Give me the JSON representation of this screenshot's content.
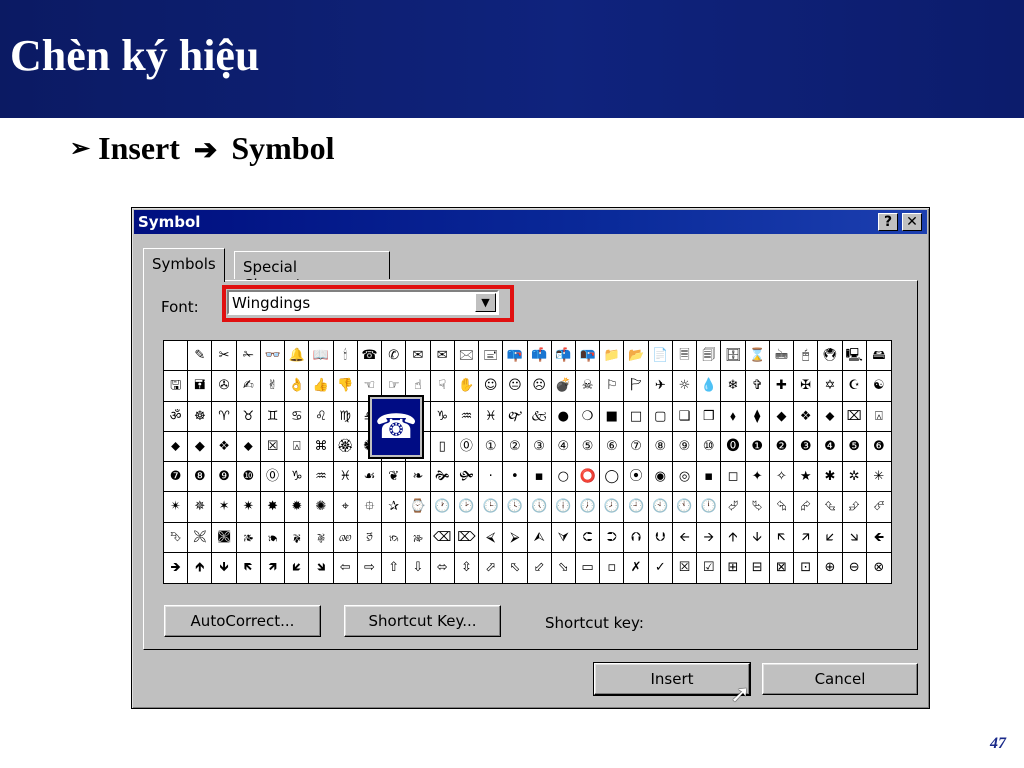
{
  "slide": {
    "title": "Chèn ký hiệu",
    "bullet_marker": "➢",
    "bullet_part1": "Insert",
    "bullet_arrow": "➔",
    "bullet_part2": "Symbol",
    "page_number": "47",
    "colors": {
      "header": "#0f237d",
      "title_text": "#ffffff",
      "highlight": "#e01010",
      "page_number": "#1a2a8a"
    }
  },
  "dialog": {
    "title": "Symbol",
    "help_button": "?",
    "close_button": "✕",
    "tabs": [
      {
        "label": "Symbols",
        "active": true
      },
      {
        "label": "Special Characters",
        "active": false
      }
    ],
    "font_label": "Font:",
    "font_value": "Wingdings",
    "selected_symbol": "☎",
    "buttons": {
      "autocorrect": "AutoCorrect...",
      "shortcut_key": "Shortcut Key...",
      "insert": "Insert",
      "cancel": "Cancel"
    },
    "shortcut_key_label": "Shortcut key:",
    "symbols": [
      "",
      "✎",
      "✂",
      "✁",
      "👓",
      "🔔",
      "📖",
      "🕯",
      "☎",
      "✆",
      "✉",
      "✉",
      "🖂",
      "🖃",
      "📪",
      "📫",
      "📬",
      "📭",
      "📁",
      "📂",
      "📄",
      "🗏",
      "🗐",
      "🗄",
      "⌛",
      "🖮",
      "🖰",
      "🖲",
      "🖳",
      "🖴",
      "🖫",
      "🖬",
      "✇",
      "✍",
      "✌",
      "👌",
      "👍",
      "👎",
      "☜",
      "☞",
      "☝",
      "☟",
      "✋",
      "☺",
      "😐",
      "☹",
      "💣",
      "☠",
      "⚐",
      "🏱",
      "✈",
      "☼",
      "💧",
      "❄",
      "✞",
      "✚",
      "✠",
      "✡",
      "☪",
      "☯",
      "ॐ",
      "☸",
      "♈",
      "♉",
      "♊",
      "♋",
      "♌",
      "♍",
      "♎",
      "♏",
      "♐",
      "♑",
      "♒",
      "♓",
      "🙰",
      "🙵",
      "●",
      "❍",
      "■",
      "□",
      "▢",
      "❑",
      "❒",
      "⬧",
      "⧫",
      "◆",
      "❖",
      "⬥",
      "⌧",
      "⍓",
      "⬥",
      "◆",
      "❖",
      "⬥",
      "☒",
      "⍓",
      "⌘",
      "🏵",
      "🏶",
      "❝",
      "❞",
      "▯",
      "⓪",
      "①",
      "②",
      "③",
      "④",
      "⑤",
      "⑥",
      "⑦",
      "⑧",
      "⑨",
      "⑩",
      "⓿",
      "❶",
      "❷",
      "❸",
      "❹",
      "❺",
      "❻",
      "❼",
      "❽",
      "❾",
      "❿",
      "⓪",
      "♑",
      "♒",
      "♓",
      "☙",
      "❦",
      "❧",
      "🙞",
      "🙟",
      "·",
      "•",
      "▪",
      "○",
      "⭕",
      "◯",
      "⦿",
      "◉",
      "◎",
      "▪",
      "◻",
      "✦",
      "✧",
      "★",
      "✱",
      "✲",
      "✳",
      "✴",
      "✵",
      "✶",
      "✷",
      "✸",
      "✹",
      "✺",
      "⌖",
      "⯐",
      "✰",
      "⌚",
      "🕐",
      "🕑",
      "🕒",
      "🕓",
      "🕔",
      "🕕",
      "🕖",
      "🕗",
      "🕘",
      "🕙",
      "🕚",
      "🕛",
      "⮰",
      "⮱",
      "⮲",
      "⮳",
      "⮴",
      "⮵",
      "⮶",
      "⮷",
      "🙪",
      "🙫",
      "🙕",
      "🙔",
      "🙗",
      "🙖",
      "🙐",
      "🙑",
      "🙒",
      "🙓",
      "⌫",
      "⌦",
      "⮘",
      "⮚",
      "⮙",
      "⮛",
      "⮈",
      "⮊",
      "⮉",
      "⮋",
      "🡨",
      "🡪",
      "🡩",
      "🡫",
      "🡬",
      "🡭",
      "🡯",
      "🡮",
      "🡸",
      "🡺",
      "🡹",
      "🡻",
      "🡼",
      "🡽",
      "🡿",
      "🡾",
      "⇦",
      "⇨",
      "⇧",
      "⇩",
      "⬄",
      "⇳",
      "⬀",
      "⬁",
      "⬃",
      "⬂",
      "▭",
      "▫",
      "✗",
      "✓",
      "☒",
      "☑",
      "⊞",
      "⊟",
      "⊠",
      "⊡",
      "⊕",
      "⊖",
      "⊗"
    ]
  }
}
